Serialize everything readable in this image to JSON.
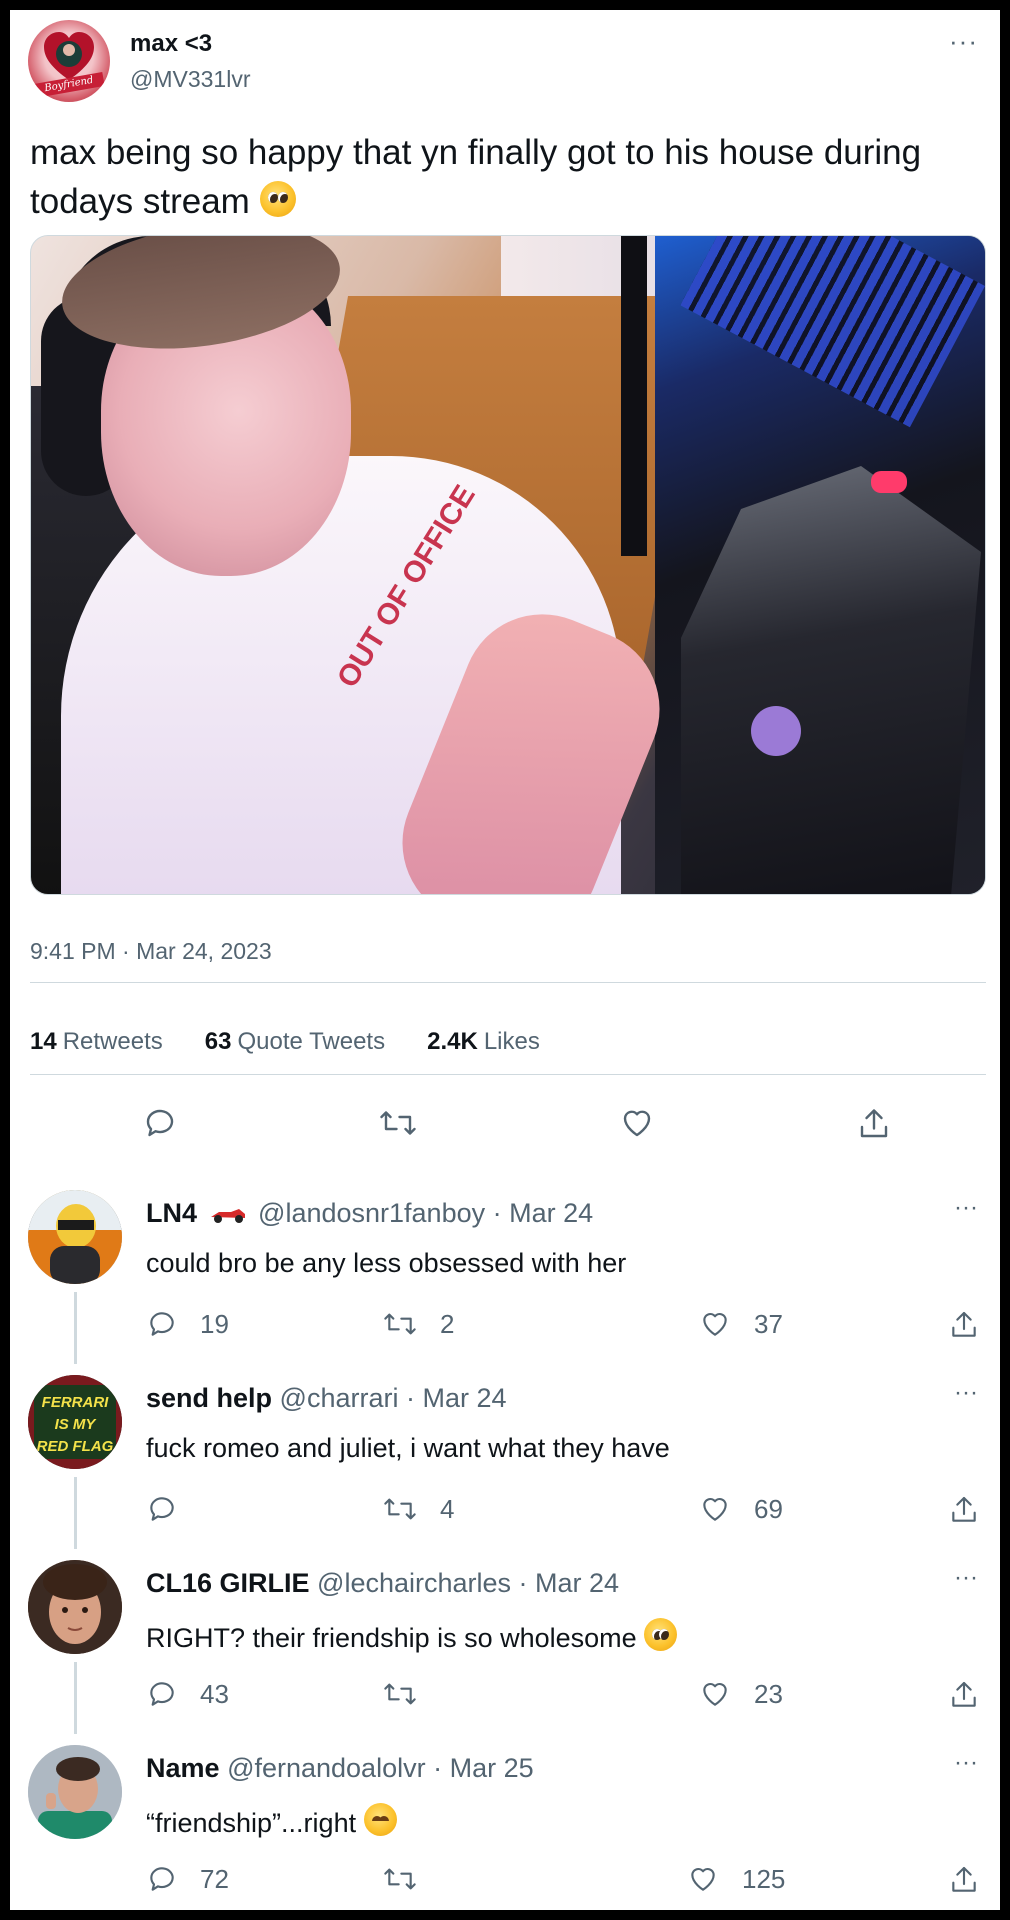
{
  "tweet": {
    "author_name": "max <3",
    "author_handle": "@MV331lvr",
    "avatar_banner": "Boyfriend",
    "text": "max being so happy that yn finally got to his house during todays stream",
    "media_shirt_text": "OUT OF OFFICE",
    "timestamp": "9:41 PM · Mar 24, 2023",
    "stats": {
      "retweets_count": "14",
      "retweets_label": "Retweets",
      "quotes_count": "63",
      "quotes_label": "Quote Tweets",
      "likes_count": "2.4K",
      "likes_label": "Likes"
    },
    "more_label": "···"
  },
  "replies": [
    {
      "name": "LN4",
      "name_emoji": "race-car-icon",
      "meta": "@landosnr1fanboy · Mar 24",
      "text": "could bro be any less obsessed with her",
      "reply_count": "19",
      "retweet_count": "2",
      "like_count": "37"
    },
    {
      "name": "send help",
      "meta": "@charrari · Mar 24",
      "text": "fuck romeo and juliet, i want what they have",
      "reply_count": "",
      "retweet_count": "4",
      "like_count": "69",
      "avatar_lines": [
        "FERRARI",
        "IS MY",
        "RED FLAG"
      ]
    },
    {
      "name": "CL16 GIRLIE",
      "meta": "@lechaircharles · Mar 24",
      "text": "RIGHT? their friendship is so wholesome",
      "reply_count": "43",
      "retweet_count": "",
      "like_count": "23"
    },
    {
      "name": "Name",
      "meta": "@fernandoalolvr · Mar 25",
      "text": "“friendship”...right",
      "reply_count": "72",
      "retweet_count": "",
      "like_count": "125"
    }
  ],
  "colors": {
    "text_primary": "#0f1419",
    "text_secondary": "#536471",
    "divider": "#cfd9de"
  }
}
